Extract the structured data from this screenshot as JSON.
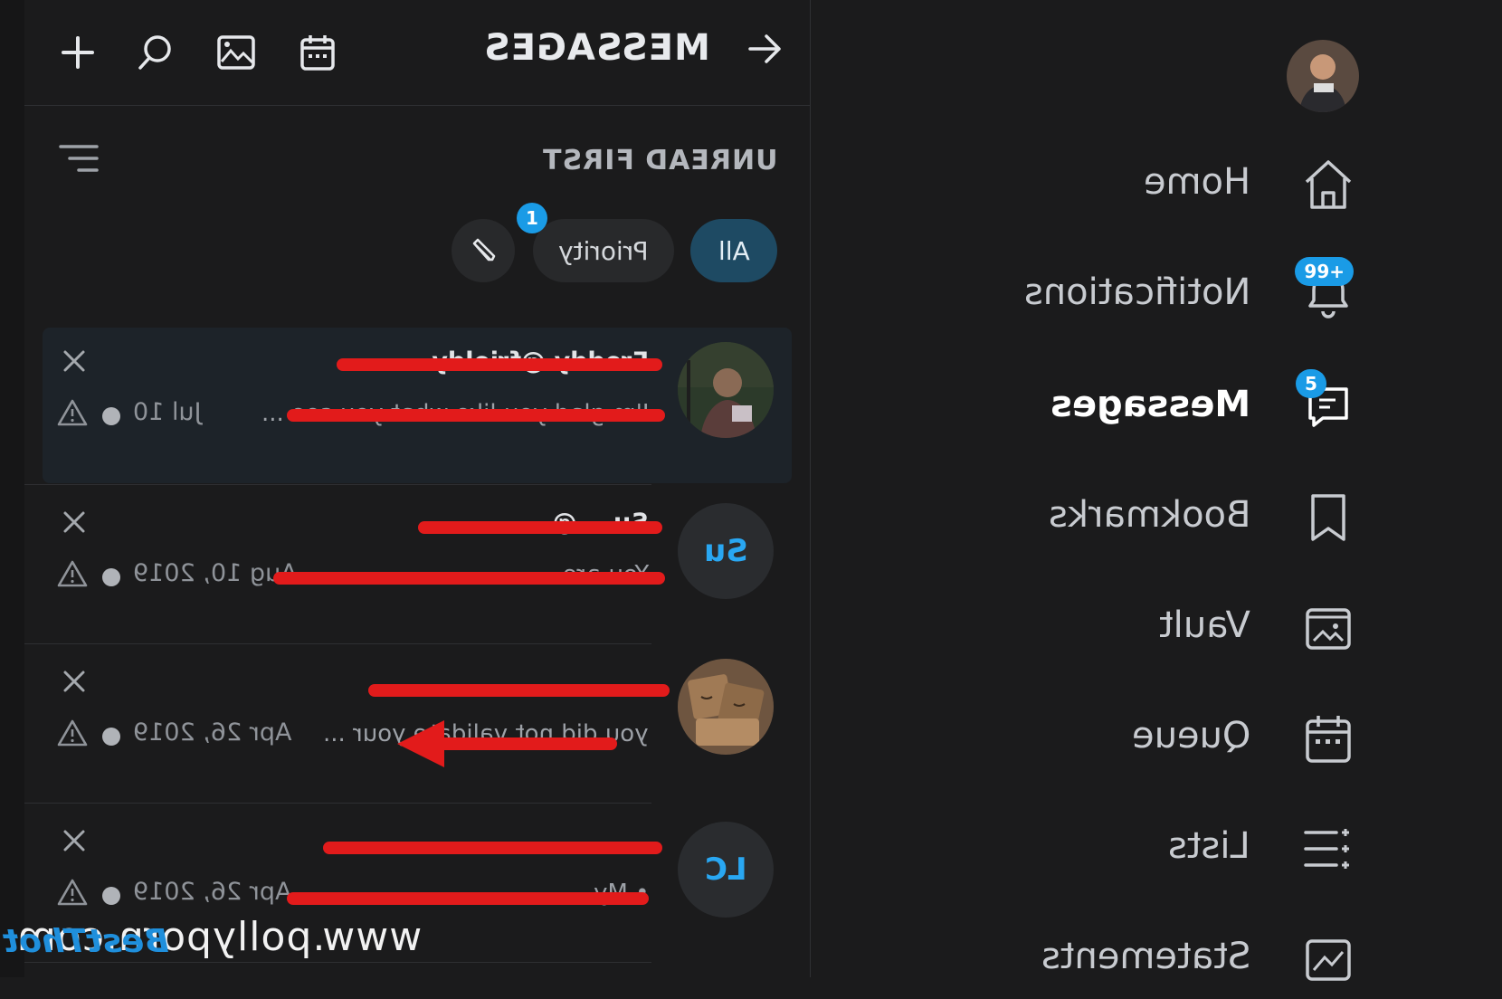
{
  "header": {
    "title": "MESSAGES"
  },
  "toolbar_icons": [
    "plus-icon",
    "search-icon",
    "image-icon",
    "calendar-icon"
  ],
  "list_controls": {
    "sort_label": "UNREAD FIRST",
    "chips": {
      "all": "All",
      "priority": "Priority",
      "priority_badge": "1"
    }
  },
  "conversations": [
    {
      "initials": "",
      "name": "Freddy @frieldy...",
      "preview": "I'm glad you like what you see ...",
      "date": "Jul 10",
      "active": true
    },
    {
      "initials": "Su",
      "name": "Su... @...",
      "preview": "You are ...",
      "date": "Aug 10, 2019",
      "active": false
    },
    {
      "initials": "",
      "name": "...",
      "preview": "you did not validate your ...",
      "date": "Apr 26, 2019",
      "active": false
    },
    {
      "initials": "LC",
      "name": "...",
      "preview": "• My ...",
      "date": "Apr 26, 2019",
      "active": false
    }
  ],
  "sidebar": {
    "items": [
      {
        "label": "Home",
        "icon": "home-icon",
        "badge": ""
      },
      {
        "label": "Notifications",
        "icon": "bell-icon",
        "badge": "99+"
      },
      {
        "label": "Messages",
        "icon": "chat-icon",
        "badge": "5"
      },
      {
        "label": "Bookmarks",
        "icon": "bookmark-icon",
        "badge": ""
      },
      {
        "label": "Vault",
        "icon": "vault-icon",
        "badge": ""
      },
      {
        "label": "Queue",
        "icon": "calendar-icon",
        "badge": ""
      },
      {
        "label": "Lists",
        "icon": "lists-icon",
        "badge": ""
      },
      {
        "label": "Statements",
        "icon": "statements-icon",
        "badge": ""
      }
    ]
  },
  "watermark": {
    "site": "www.pollyporn.com",
    "logo_text": "BestThot"
  },
  "colors": {
    "accent": "#1a9be6",
    "background": "#1b1b1c",
    "redaction": "#e21b1b"
  }
}
